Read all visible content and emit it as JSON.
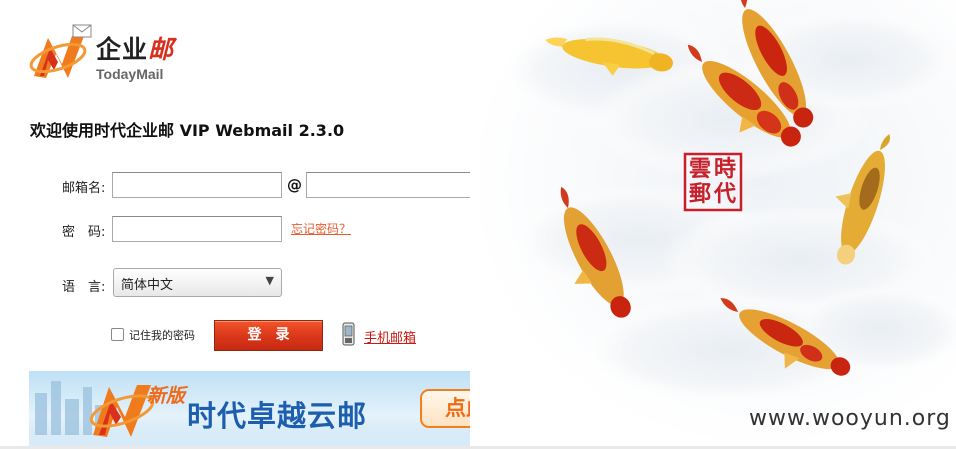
{
  "logo": {
    "name_black": "企业",
    "name_red": "邮",
    "name_en": "TodayMail"
  },
  "welcome": "欢迎使用时代企业邮 VIP Webmail 2.3.0",
  "form": {
    "mailbox_label": "邮箱名:",
    "mailbox_user_value": "",
    "at_sign": "@",
    "mailbox_domain_value": "",
    "password_label": "密　码:",
    "password_value": "",
    "forgot_link": "忘记密码？",
    "language_label": "语　言:",
    "language_selected": "简体中文",
    "remember_label": "记住我的密码",
    "remember_checked": false,
    "login_button": "登录",
    "mobile_link": "手机邮箱"
  },
  "banner": {
    "tag": "新版",
    "title": "时代卓越云邮",
    "cta": "点此登录"
  },
  "seal": {
    "chars": [
      "時",
      "代",
      "雲",
      "郵"
    ]
  },
  "watermark": "www.wooyun.org",
  "colors": {
    "brand_red": "#d8301d",
    "link_orange": "#e55d2f",
    "banner_blue": "#1d5fae",
    "cta_orange": "#f06a12"
  },
  "icons": {
    "logo": "todaymail-logo-icon",
    "phone": "mobile-phone-icon",
    "dropdown": "chevron-down-icon"
  }
}
